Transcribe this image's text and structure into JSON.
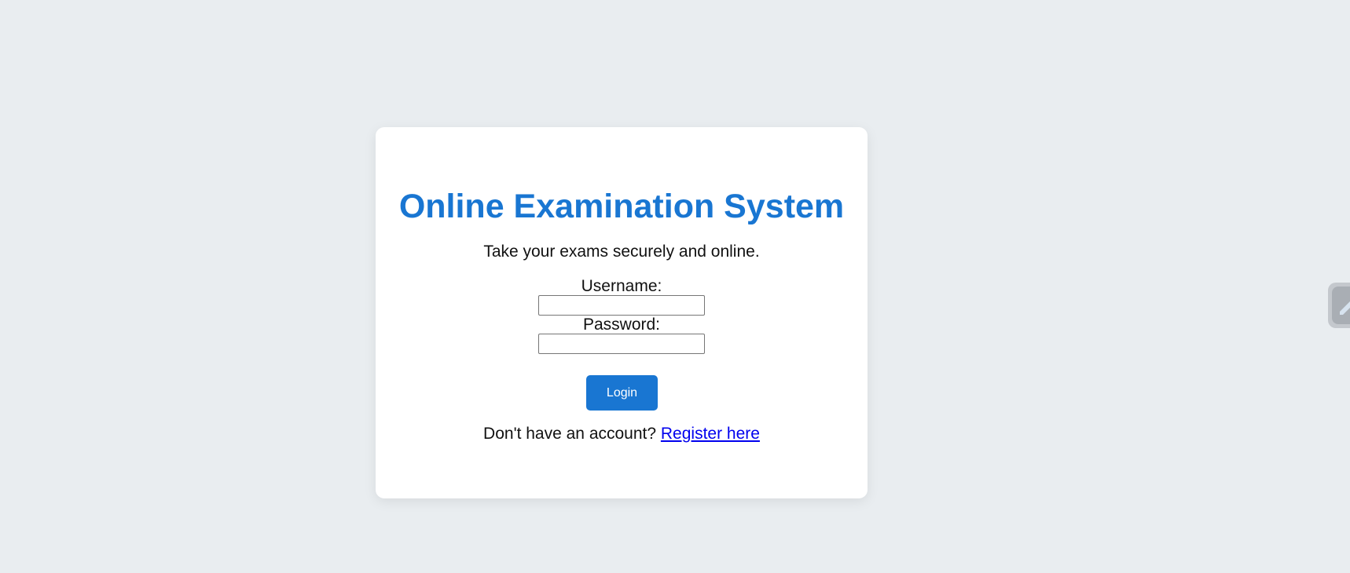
{
  "app": {
    "title": "Online Examination System",
    "subtitle": "Take your exams securely and online."
  },
  "login_form": {
    "username_label": "Username:",
    "username_value": "",
    "password_label": "Password:",
    "password_value": "",
    "submit_label": "Login"
  },
  "register": {
    "prompt": "Don't have an account?",
    "link_label": "Register here"
  },
  "side_widget": {
    "icon": "edit-icon"
  },
  "colors": {
    "accent": "#1976d2",
    "page_background": "#e9edf0",
    "card_background": "#ffffff",
    "link": "#0000ee"
  }
}
